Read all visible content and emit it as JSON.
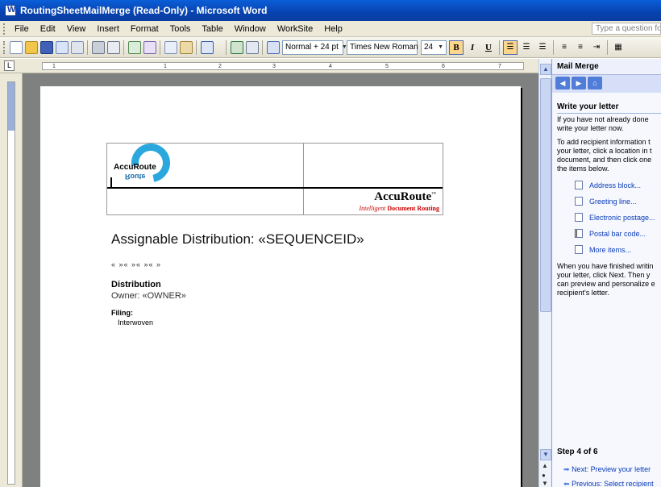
{
  "window": {
    "title": "RoutingSheetMailMerge (Read-Only) - Microsoft Word"
  },
  "menu": {
    "items": [
      "File",
      "Edit",
      "View",
      "Insert",
      "Format",
      "Tools",
      "Table",
      "Window",
      "WorkSite",
      "Help"
    ],
    "help_placeholder": "Type a question for"
  },
  "toolbar": {
    "style": "Normal + 24 pt",
    "font": "Times New Roman",
    "size": "24",
    "bold": "B",
    "italic": "I",
    "underline": "U"
  },
  "ruler": {
    "ticks": [
      "1",
      "1",
      "2",
      "3",
      "4",
      "5",
      "6",
      "7"
    ]
  },
  "document": {
    "brand": "AccuRoute",
    "brand_tm": "™",
    "tagline_italic": "Intelligent",
    "tagline_bold": "Document Routing",
    "logo_text": "AccuRoute",
    "logo_mirror": "Route",
    "title": "Assignable Distribution: «SEQUENCEID»",
    "codes": "«  »«  »«  »«  »",
    "distribution_heading": "Distribution",
    "owner": "Owner: «OWNER»",
    "filing_heading": "Filing:",
    "filing_value": "Interwoven"
  },
  "taskpane": {
    "title": "Mail Merge",
    "section_heading": "Write your letter",
    "intro_lines": [
      "If you have not already done",
      "write your letter now."
    ],
    "add_lines": [
      "To add recipient information t",
      "your letter, click a location in t",
      "document, and then click one",
      "the items below."
    ],
    "links": [
      "Address block...",
      "Greeting line...",
      "Electronic postage...",
      "Postal bar code...",
      "More items..."
    ],
    "finished_lines": [
      "When you have finished writin",
      "your letter, click Next. Then y",
      "can preview and personalize e",
      "recipient's letter."
    ],
    "step": "Step 4 of 6",
    "next_link": "Next: Preview your letter",
    "prev_link": "Previous: Select recipient"
  },
  "colors": {
    "titlebar": "#0842b0",
    "task_link": "#0a3bb6",
    "tagline": "#cc0000",
    "logo_ring": "#2aa8dd"
  }
}
